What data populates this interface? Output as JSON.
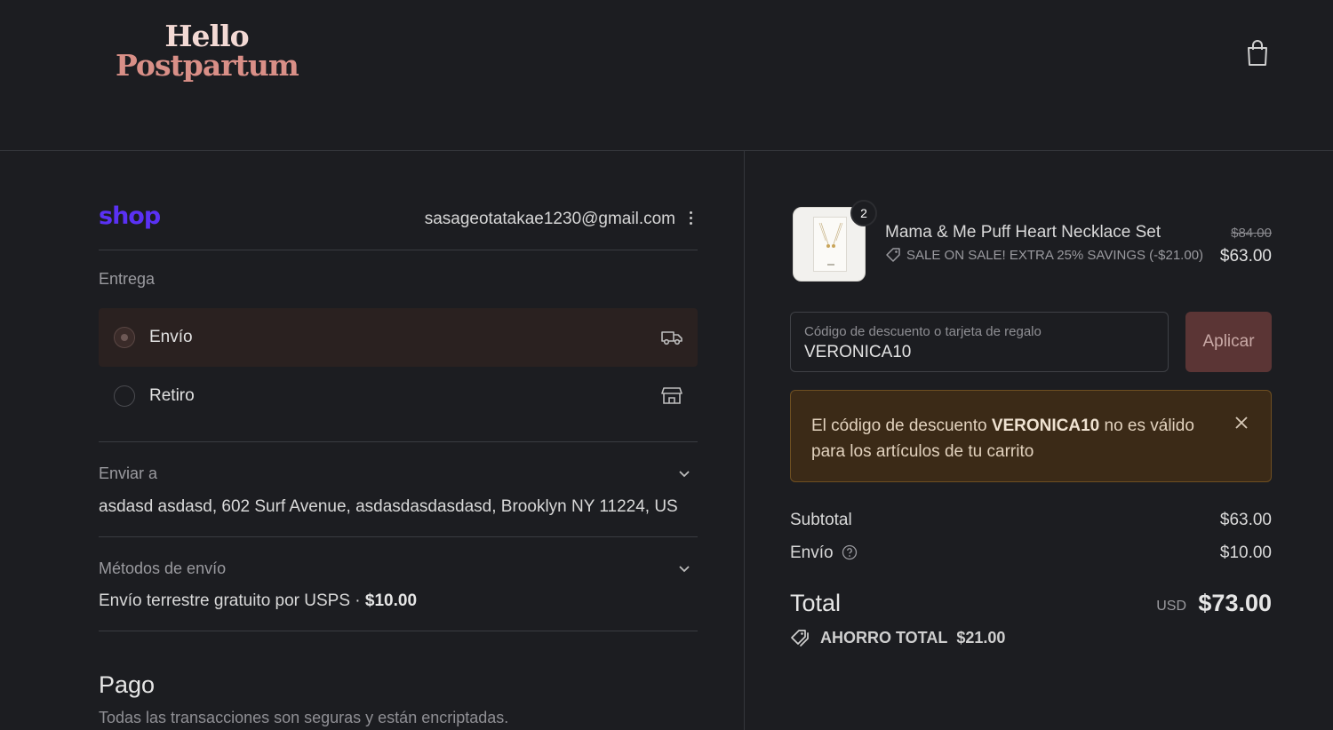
{
  "header": {
    "logo_line1": "Hello",
    "logo_line2": "Postpartum"
  },
  "account": {
    "shop_logo": "shop",
    "email": "sasageotatakae1230@gmail.com"
  },
  "delivery": {
    "title": "Entrega",
    "options": [
      {
        "label": "Envío",
        "icon": "truck-icon",
        "selected": true
      },
      {
        "label": "Retiro",
        "icon": "store-icon",
        "selected": false
      }
    ]
  },
  "ship_to": {
    "title": "Enviar a",
    "address": "asdasd asdasd, 602 Surf Avenue, asdasdasdasdasd, Brooklyn NY 11224, US"
  },
  "shipping_method": {
    "title": "Métodos de envío",
    "name": "Envío terrestre gratuito por USPS",
    "separator": "·",
    "price": "$10.00"
  },
  "payment": {
    "title": "Pago",
    "subtitle": "Todas las transacciones son seguras y están encriptadas."
  },
  "order": {
    "item": {
      "quantity": "2",
      "name": "Mama & Me Puff Heart Necklace Set",
      "discount": "SALE ON SALE! EXTRA 25% SAVINGS (-$21.00)",
      "old_price": "$84.00",
      "price": "$63.00"
    },
    "discount_field": {
      "placeholder": "Código de descuento o tarjeta de regalo",
      "value": "VERONICA10",
      "button": "Aplicar"
    },
    "alert": {
      "before": "El código de descuento ",
      "code": "VERONICA10",
      "after": " no es válido para los artículos de tu carrito"
    },
    "subtotal_label": "Subtotal",
    "subtotal": "$63.00",
    "shipping_label": "Envío",
    "shipping": "$10.00",
    "total_label": "Total",
    "currency": "USD",
    "total": "$73.00",
    "savings_label": "AHORRO TOTAL",
    "savings": "$21.00"
  },
  "colors": {
    "background": "#1c1d21",
    "brand_shop": "#5a31f4",
    "logo_accent": "#d98f87",
    "apply_button": "#5b3535",
    "alert_bg": "#3b2a17"
  }
}
